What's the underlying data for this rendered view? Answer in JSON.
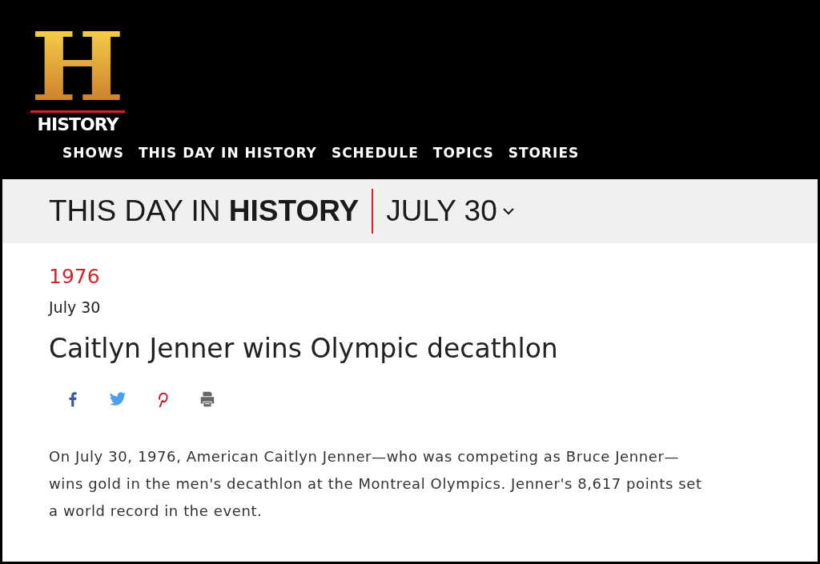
{
  "logo": {
    "mark": "H",
    "wordmark": "HISTORY"
  },
  "nav": [
    {
      "label": "SHOWS"
    },
    {
      "label": "THIS DAY IN HISTORY"
    },
    {
      "label": "SCHEDULE"
    },
    {
      "label": "TOPICS"
    },
    {
      "label": "STORIES"
    }
  ],
  "date_bar": {
    "title": "THIS DAY IN **HISTORY**",
    "date": "JULY 30"
  },
  "article": {
    "year": "1976",
    "date": "July 30",
    "headline": "Caitlyn Jenner wins Olympic decathlon",
    "body": "On July 30, 1976, American Caitlyn Jenner—who was competing as Bruce Jenner—wins gold in the men's decathlon at the Montreal Olympics. Jenner's 8,617 points set a world record in the event."
  }
}
